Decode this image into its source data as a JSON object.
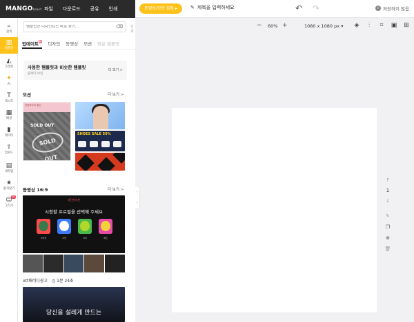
{
  "header": {
    "logo": "MANGO",
    "logo_sub": "board",
    "menu": [
      "파일",
      "다운로드",
      "공유",
      "인쇄"
    ],
    "mode_button": "동영상/모션 설정",
    "title_placeholder": "제목을 입력하세요",
    "save_status": "저장하지 않음"
  },
  "rail": [
    {
      "label": "검색",
      "icon": "search-icon"
    },
    {
      "label": "템플릿",
      "icon": "template-icon",
      "active": true
    },
    {
      "label": "그래픽",
      "icon": "graphic-icon"
    },
    {
      "label": "AI",
      "icon": "ai-icon"
    },
    {
      "label": "텍스트",
      "icon": "text-icon"
    },
    {
      "label": "배경",
      "icon": "background-icon"
    },
    {
      "label": "데이터",
      "icon": "chart-icon"
    },
    {
      "label": "업로드",
      "icon": "upload-icon"
    },
    {
      "label": "내작업",
      "icon": "my-work-icon"
    },
    {
      "label": "즐겨찾기",
      "icon": "star-icon"
    },
    {
      "label": "그리기",
      "icon": "draw-icon",
      "badge": "N"
    }
  ],
  "panel": {
    "search_placeholder": "템플릿과 디자인요소 바로 찾기...",
    "side_label": "상세",
    "tabs": [
      "업데이트",
      "디자인",
      "동영상",
      "모션",
      "받은 템플릿"
    ],
    "tab_badge": "N",
    "banner": {
      "title": "사용한 템플릿과 비슷한 템플릿",
      "sub": "블랙다-보임",
      "more": "더 보기 >"
    },
    "section_motion": {
      "title": "모션",
      "more": "더 보기 >"
    },
    "soldout_top": "연말마무리 할인",
    "soldout_label": "SOLD OUT",
    "stamp": "SOLD OUT",
    "shoes_label": "SHOES SALE 50%",
    "section_video": {
      "title": "동영상 16:9",
      "more": "더 보기 >"
    },
    "video_header": "대단한추천",
    "video_title": "시청할 프로필을 선택해 주세요",
    "avatars": [
      "아이들",
      "지명",
      "하피",
      "빠르"
    ],
    "video_caption": "ott패러디광고",
    "video_duration": "1분 24초",
    "video_bottom_title": "당신을 설레게 만드는"
  },
  "canvas": {
    "zoom": "60%",
    "size": "1080 x 1080 px",
    "page_number": "1"
  },
  "colors": {
    "accent": "#ffc21a",
    "badge": "#e84a5f",
    "dark": "#2b2b2b"
  }
}
